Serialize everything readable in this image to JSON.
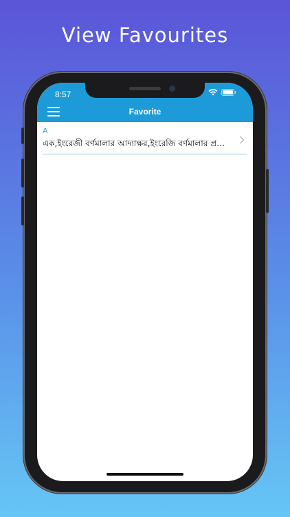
{
  "promo": {
    "title": "View Favourites"
  },
  "status_bar": {
    "time": "8:57"
  },
  "nav": {
    "title": "Favorite"
  },
  "favorites": [
    {
      "letter": "A",
      "text": "এক,ইংরেজী বর্ণমালার আদ্যাক্ষর,ইংরেজি বর্ণমালার প্রথম অক্ষর"
    }
  ],
  "colors": {
    "header": "#1d9bd9",
    "accent": "#1d9bd9"
  },
  "icons": {
    "menu": "hamburger-menu-icon",
    "wifi": "wifi-icon",
    "battery": "battery-icon",
    "chevron": "chevron-right-icon"
  }
}
